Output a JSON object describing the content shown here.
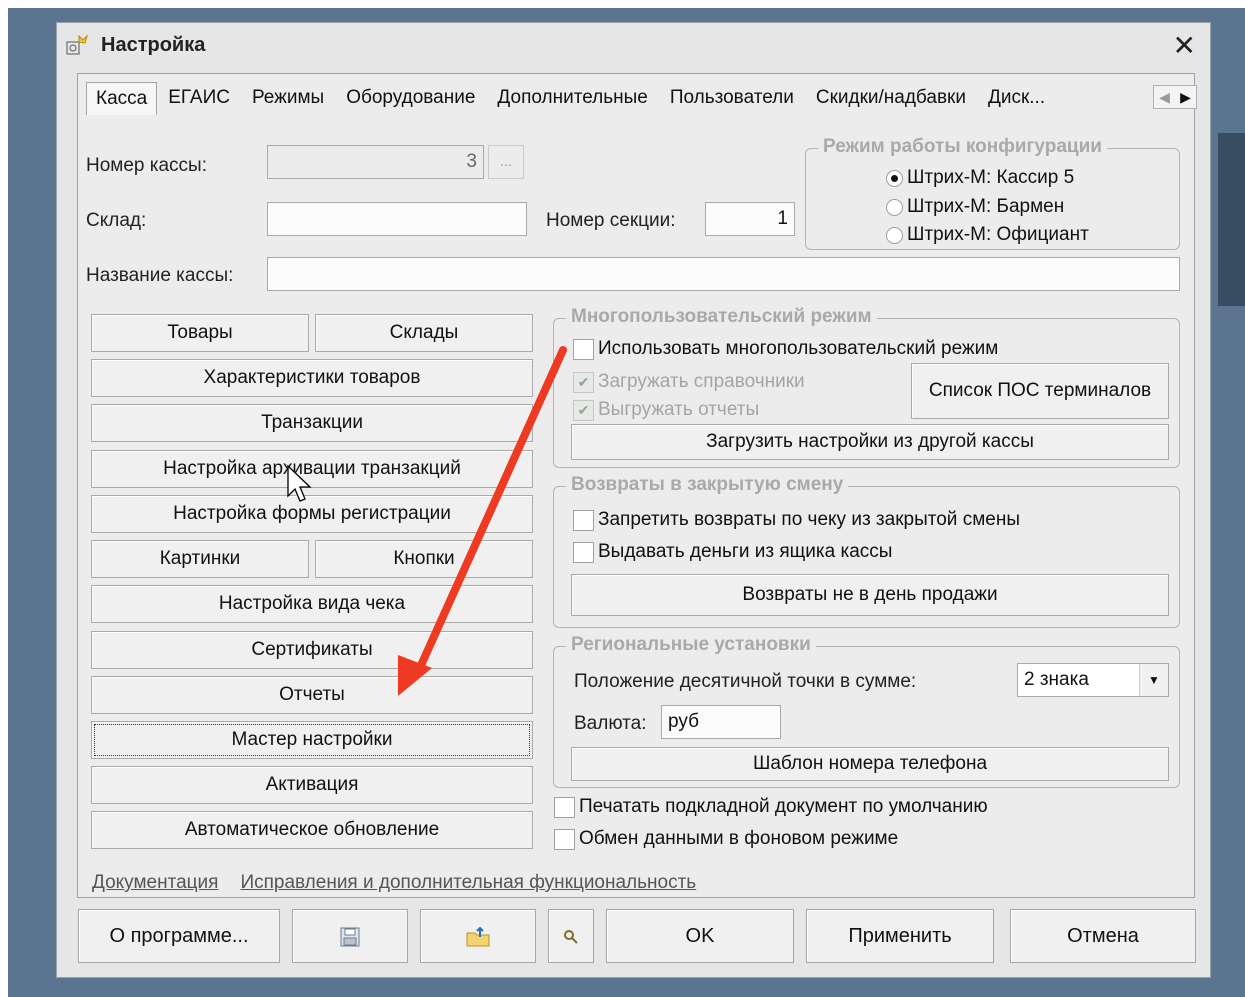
{
  "window": {
    "title": "Настройка",
    "close_label": "✕"
  },
  "tabs": [
    "Касса",
    "ЕГАИС",
    "Режимы",
    "Оборудование",
    "Дополнительные",
    "Пользователи",
    "Скидки/надбавки",
    "Диск..."
  ],
  "tab_scroll": {
    "left": "◀",
    "right": "▶"
  },
  "register": {
    "number_label": "Номер кассы:",
    "number_value": "3",
    "number_button": "...",
    "warehouse_label": "Склад:",
    "warehouse_value": "",
    "section_label": "Номер секции:",
    "section_value": "1",
    "name_label": "Название кассы:",
    "name_value": ""
  },
  "config_mode": {
    "title": "Режим работы конфигурации",
    "options": [
      "Штрих-М: Кассир 5",
      "Штрих-М: Бармен",
      "Штрих-М: Официант"
    ],
    "selected": "Штрих-М: Кассир 5"
  },
  "left_buttons": {
    "goods": "Товары",
    "warehouses": "Склады",
    "goods_chars": "Характеристики товаров",
    "transactions": "Транзакции",
    "archive": "Настройка архивации транзакций",
    "reg_form": "Настройка формы регистрации",
    "pictures": "Картинки",
    "buttons": "Кнопки",
    "receipt_view": "Настройка вида чека",
    "certificates": "Сертификаты",
    "reports": "Отчеты",
    "wizard": "Мастер настройки",
    "activation": "Активация",
    "auto_update": "Автоматическое обновление"
  },
  "multiuser": {
    "title": "Многопользовательский режим",
    "use_label": "Использовать многопользовательский режим",
    "load_refs_label": "Загружать справочники",
    "upload_reports_label": "Выгружать отчеты",
    "pos_list_button": "Список ПОС терминалов",
    "load_settings_button": "Загрузить настройки из другой кассы"
  },
  "returns": {
    "title": "Возвраты в закрытую смену",
    "forbid_label": "Запретить возвраты по чеку из закрытой смены",
    "cash_drawer_label": "Выдавать деньги из ящика кассы",
    "not_sale_day_button": "Возвраты не в день продажи"
  },
  "regional": {
    "title": "Региональные установки",
    "decimal_label": "Положение десятичной точки в сумме:",
    "decimal_value": "2 знака",
    "currency_label": "Валюта:",
    "currency_value": "руб",
    "phone_template_button": "Шаблон номера телефона"
  },
  "options": {
    "print_label": "Печатать подкладной документ по умолчанию",
    "background_label": "Обмен данными в фоновом режиме"
  },
  "links": {
    "docs": "Документация",
    "fixes": "Исправления и дополнительная функциональность"
  },
  "footer": {
    "about": "О программе...",
    "ok": "OK",
    "apply": "Применить",
    "cancel": "Отмена"
  },
  "colors": {
    "annotation_arrow": "#ee3a22",
    "desktop": "#5b7590"
  }
}
